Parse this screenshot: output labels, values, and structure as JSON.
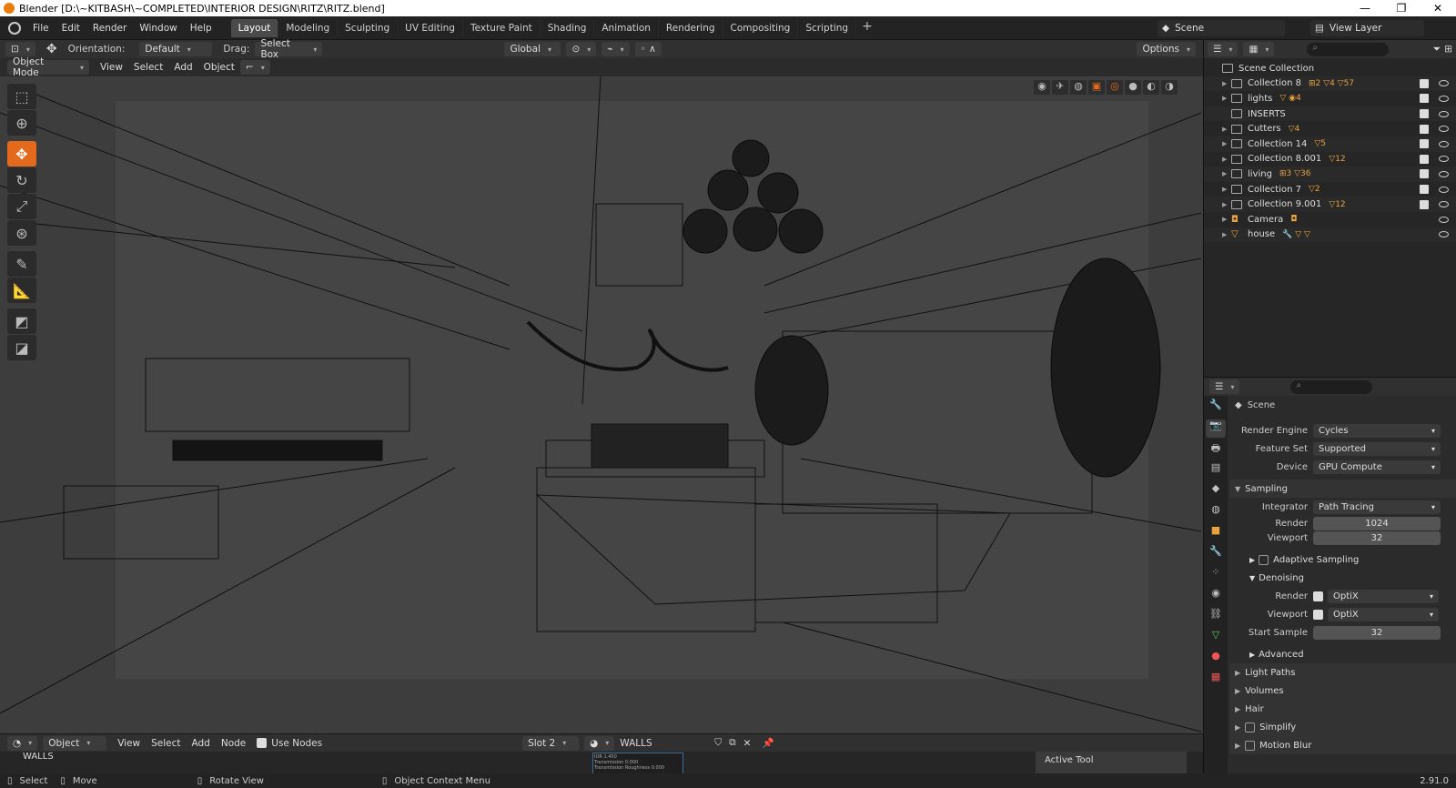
{
  "window": {
    "title": "Blender [D:\\~KITBASH\\~COMPLETED\\INTERIOR DESIGN\\RITZ\\RITZ.blend]",
    "controls": [
      "—",
      "❐",
      "✕"
    ]
  },
  "menu": [
    "File",
    "Edit",
    "Render",
    "Window",
    "Help"
  ],
  "workspaces": [
    "Layout",
    "Modeling",
    "Sculpting",
    "UV Editing",
    "Texture Paint",
    "Shading",
    "Animation",
    "Rendering",
    "Compositing",
    "Scripting"
  ],
  "active_workspace": "Layout",
  "scene": "Scene",
  "view_layer": "View Layer",
  "viewport_header": {
    "orientation_label": "Orientation:",
    "orientation_value": "Default",
    "drag_label": "Drag:",
    "drag_value": "Select Box",
    "transform_space": "Global",
    "options": "Options"
  },
  "viewport_header2": {
    "mode": "Object Mode",
    "menu": [
      "View",
      "Select",
      "Add",
      "Object"
    ]
  },
  "node_header": {
    "editor_type": "Object",
    "menu": [
      "View",
      "Select",
      "Add",
      "Node"
    ],
    "use_nodes": "Use Nodes",
    "slot": "Slot 2",
    "material": "WALLS"
  },
  "node_area": {
    "material_label": "WALLS",
    "mini_rows": [
      "IOR 1.450",
      "Transmission 0.000",
      "Transmission Roughness 0.000"
    ],
    "active_tool": "Active Tool"
  },
  "status": {
    "select": "Select",
    "move": "Move",
    "rotate": "Rotate View",
    "context": "Object Context Menu",
    "version": "2.91.0"
  },
  "outliner": {
    "root": "Scene Collection",
    "items": [
      {
        "name": "Collection 8",
        "badges": "⊞2 ▽4 ▽57",
        "checked": true
      },
      {
        "name": "lights",
        "badges": "▽ ◉4",
        "checked": true
      },
      {
        "name": "INSERTS",
        "badges": "",
        "checked": true
      },
      {
        "name": "Cutters",
        "badges": "▽4",
        "checked": true
      },
      {
        "name": "Collection 14",
        "badges": "▽5",
        "checked": true
      },
      {
        "name": "Collection 8.001",
        "badges": "▽12",
        "checked": true
      },
      {
        "name": "living",
        "badges": "⊞3 ▽36",
        "checked": true
      },
      {
        "name": "Collection 7",
        "badges": "▽2",
        "checked": true
      },
      {
        "name": "Collection 9.001",
        "badges": "▽12",
        "checked": true
      },
      {
        "name": "Camera",
        "badges": "◘",
        "checked": false
      },
      {
        "name": "house",
        "badges": "🔧 ▽ ▽",
        "checked": false
      }
    ]
  },
  "properties": {
    "context": "Scene",
    "render_engine_label": "Render Engine",
    "render_engine": "Cycles",
    "feature_set_label": "Feature Set",
    "feature_set": "Supported",
    "device_label": "Device",
    "device": "GPU Compute",
    "sampling": "Sampling",
    "integrator_label": "Integrator",
    "integrator": "Path Tracing",
    "render_label": "Render",
    "render_samples": "1024",
    "viewport_label": "Viewport",
    "viewport_samples": "32",
    "adaptive_sampling": "Adaptive Sampling",
    "denoising": "Denoising",
    "denoise_render": "OptiX",
    "denoise_viewport": "OptiX",
    "start_sample_label": "Start Sample",
    "start_sample": "32",
    "advanced": "Advanced",
    "light_paths": "Light Paths",
    "volumes": "Volumes",
    "hair": "Hair",
    "simplify": "Simplify",
    "motion_blur": "Motion Blur"
  }
}
